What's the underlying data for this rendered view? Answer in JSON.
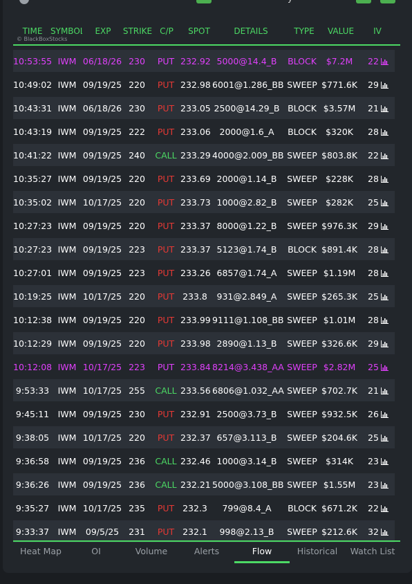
{
  "header": {
    "columns": [
      "TIME",
      "SYMBOL",
      "EXP",
      "STRIKE",
      "C/P",
      "SPOT",
      "DETAILS",
      "TYPE",
      "VALUE",
      "IV"
    ],
    "watermark": "© BlackBoxStocks",
    "top_partial_char": "y"
  },
  "colors": {
    "accent": "#4cd964",
    "put": "#e53935",
    "call": "#4cd964",
    "highlight": "#e040fb",
    "row_alt": "#2c3138",
    "background": "#22262b"
  },
  "rows": [
    {
      "time": "10:53:55",
      "symbol": "IWM",
      "exp": "06/18/26",
      "strike": "230",
      "cp": "PUT",
      "spot": "232.92",
      "details": "5000@14.4_B",
      "type": "BLOCK",
      "value": "$7.2M",
      "iv": "22",
      "highlight": true
    },
    {
      "time": "10:49:02",
      "symbol": "IWM",
      "exp": "09/19/25",
      "strike": "220",
      "cp": "PUT",
      "spot": "232.98",
      "details": "6001@1.286_BB",
      "type": "SWEEP",
      "value": "$771.6K",
      "iv": "29",
      "highlight": false
    },
    {
      "time": "10:43:31",
      "symbol": "IWM",
      "exp": "06/18/26",
      "strike": "230",
      "cp": "PUT",
      "spot": "233.05",
      "details": "2500@14.29_B",
      "type": "BLOCK",
      "value": "$3.57M",
      "iv": "21",
      "highlight": false
    },
    {
      "time": "10:43:19",
      "symbol": "IWM",
      "exp": "09/19/25",
      "strike": "222",
      "cp": "PUT",
      "spot": "233.06",
      "details": "2000@1.6_A",
      "type": "BLOCK",
      "value": "$320K",
      "iv": "28",
      "highlight": false
    },
    {
      "time": "10:41:22",
      "symbol": "IWM",
      "exp": "09/19/25",
      "strike": "240",
      "cp": "CALL",
      "spot": "233.29",
      "details": "4000@2.009_BB",
      "type": "SWEEP",
      "value": "$803.8K",
      "iv": "22",
      "highlight": false
    },
    {
      "time": "10:35:27",
      "symbol": "IWM",
      "exp": "09/19/25",
      "strike": "220",
      "cp": "PUT",
      "spot": "233.69",
      "details": "2000@1.14_B",
      "type": "SWEEP",
      "value": "$228K",
      "iv": "28",
      "highlight": false
    },
    {
      "time": "10:35:02",
      "symbol": "IWM",
      "exp": "10/17/25",
      "strike": "220",
      "cp": "PUT",
      "spot": "233.73",
      "details": "1000@2.82_B",
      "type": "SWEEP",
      "value": "$282K",
      "iv": "25",
      "highlight": false
    },
    {
      "time": "10:27:23",
      "symbol": "IWM",
      "exp": "09/19/25",
      "strike": "220",
      "cp": "PUT",
      "spot": "233.37",
      "details": "8000@1.22_B",
      "type": "SWEEP",
      "value": "$976.3K",
      "iv": "29",
      "highlight": false
    },
    {
      "time": "10:27:23",
      "symbol": "IWM",
      "exp": "09/19/25",
      "strike": "223",
      "cp": "PUT",
      "spot": "233.37",
      "details": "5123@1.74_B",
      "type": "BLOCK",
      "value": "$891.4K",
      "iv": "28",
      "highlight": false
    },
    {
      "time": "10:27:01",
      "symbol": "IWM",
      "exp": "09/19/25",
      "strike": "223",
      "cp": "PUT",
      "spot": "233.26",
      "details": "6857@1.74_A",
      "type": "SWEEP",
      "value": "$1.19M",
      "iv": "28",
      "highlight": false
    },
    {
      "time": "10:19:25",
      "symbol": "IWM",
      "exp": "10/17/25",
      "strike": "220",
      "cp": "PUT",
      "spot": "233.8",
      "details": "931@2.849_A",
      "type": "SWEEP",
      "value": "$265.3K",
      "iv": "25",
      "highlight": false
    },
    {
      "time": "10:12:38",
      "symbol": "IWM",
      "exp": "09/19/25",
      "strike": "220",
      "cp": "PUT",
      "spot": "233.99",
      "details": "9111@1.108_BB",
      "type": "SWEEP",
      "value": "$1.01M",
      "iv": "28",
      "highlight": false
    },
    {
      "time": "10:12:29",
      "symbol": "IWM",
      "exp": "09/19/25",
      "strike": "220",
      "cp": "PUT",
      "spot": "233.98",
      "details": "2890@1.13_B",
      "type": "SWEEP",
      "value": "$326.6K",
      "iv": "29",
      "highlight": false
    },
    {
      "time": "10:12:08",
      "symbol": "IWM",
      "exp": "10/17/25",
      "strike": "223",
      "cp": "PUT",
      "spot": "233.84",
      "details": "8214@3.438_AA",
      "type": "SWEEP",
      "value": "$2.82M",
      "iv": "25",
      "highlight": true
    },
    {
      "time": "9:53:33",
      "symbol": "IWM",
      "exp": "10/17/25",
      "strike": "255",
      "cp": "CALL",
      "spot": "233.56",
      "details": "6806@1.032_AA",
      "type": "SWEEP",
      "value": "$702.7K",
      "iv": "21",
      "highlight": false
    },
    {
      "time": "9:45:11",
      "symbol": "IWM",
      "exp": "09/19/25",
      "strike": "230",
      "cp": "PUT",
      "spot": "232.91",
      "details": "2500@3.73_B",
      "type": "SWEEP",
      "value": "$932.5K",
      "iv": "26",
      "highlight": false
    },
    {
      "time": "9:38:05",
      "symbol": "IWM",
      "exp": "10/17/25",
      "strike": "220",
      "cp": "PUT",
      "spot": "232.37",
      "details": "657@3.113_B",
      "type": "SWEEP",
      "value": "$204.6K",
      "iv": "25",
      "highlight": false
    },
    {
      "time": "9:36:58",
      "symbol": "IWM",
      "exp": "09/19/25",
      "strike": "236",
      "cp": "CALL",
      "spot": "232.46",
      "details": "1000@3.14_B",
      "type": "SWEEP",
      "value": "$314K",
      "iv": "23",
      "highlight": false
    },
    {
      "time": "9:36:26",
      "symbol": "IWM",
      "exp": "09/19/25",
      "strike": "236",
      "cp": "CALL",
      "spot": "232.21",
      "details": "5000@3.108_BB",
      "type": "SWEEP",
      "value": "$1.55M",
      "iv": "23",
      "highlight": false
    },
    {
      "time": "9:35:27",
      "symbol": "IWM",
      "exp": "10/17/25",
      "strike": "235",
      "cp": "PUT",
      "spot": "232.3",
      "details": "799@8.4_A",
      "type": "BLOCK",
      "value": "$671.2K",
      "iv": "22",
      "highlight": false
    },
    {
      "time": "9:33:37",
      "symbol": "IWM",
      "exp": "09/5/25",
      "strike": "231",
      "cp": "PUT",
      "spot": "232.1",
      "details": "998@2.13_B",
      "type": "SWEEP",
      "value": "$212.6K",
      "iv": "32",
      "highlight": false
    }
  ],
  "tabs": [
    {
      "label": "Heat Map",
      "active": false
    },
    {
      "label": "OI",
      "active": false
    },
    {
      "label": "Volume",
      "active": false
    },
    {
      "label": "Alerts",
      "active": false
    },
    {
      "label": "Flow",
      "active": true
    },
    {
      "label": "Historical",
      "active": false
    },
    {
      "label": "Watch List",
      "active": false
    }
  ]
}
